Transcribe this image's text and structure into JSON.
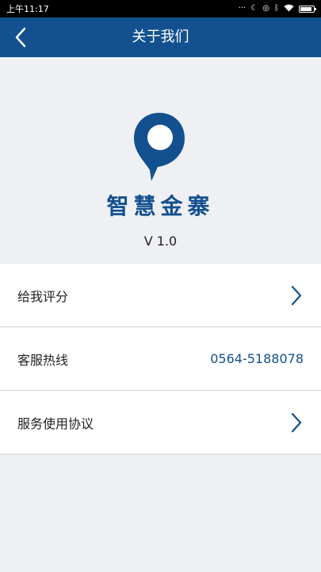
{
  "status_bar": {
    "time": "上午11:17",
    "icons": [
      "signal-dots-icon",
      "dnd-icon",
      "alarm-icon",
      "bluetooth-icon",
      "wifi-icon",
      "battery-icon"
    ]
  },
  "header": {
    "title": "关于我们"
  },
  "logo": {
    "text": "智慧金寨",
    "color": "#13508f"
  },
  "version": "V 1.0",
  "menu": {
    "items": [
      {
        "label": "给我评分",
        "value": null,
        "icon": "chevron-right-icon"
      },
      {
        "label": "客服热线",
        "value": "0564-5188078",
        "icon": null
      },
      {
        "label": "服务使用协议",
        "value": null,
        "icon": "chevron-right-icon"
      }
    ]
  },
  "colors": {
    "primary": "#13508f",
    "background": "#eef0f4",
    "divider": "#cfd2d6"
  }
}
